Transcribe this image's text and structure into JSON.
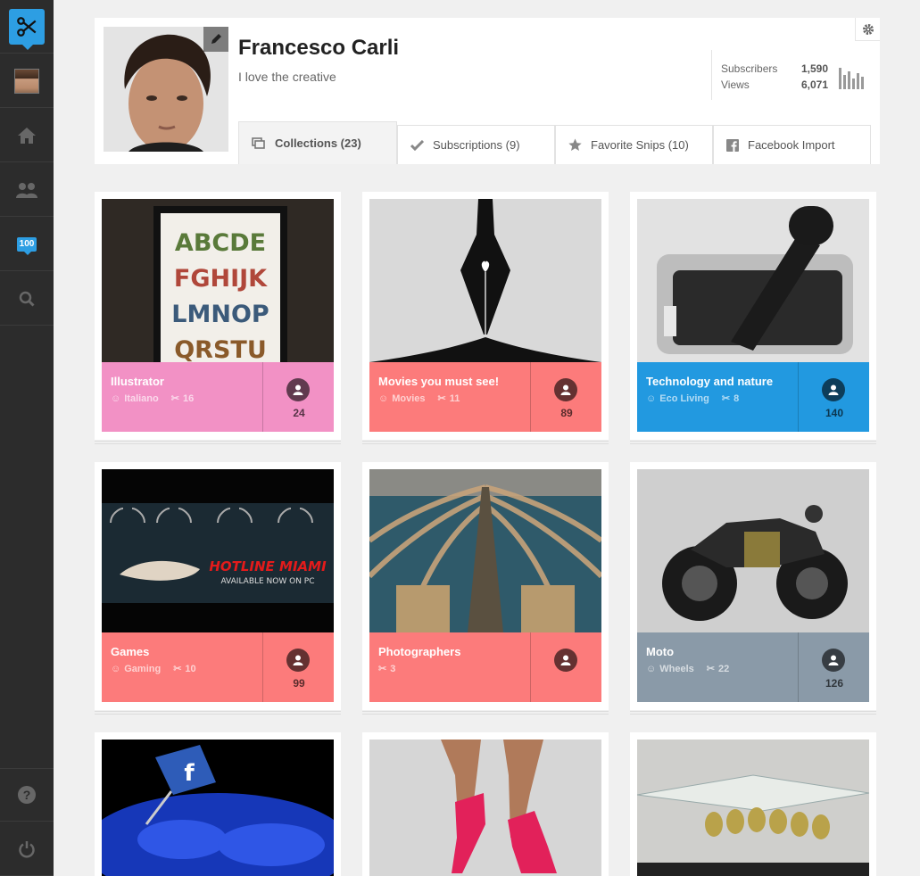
{
  "app": {
    "logo_icon": "scissors-icon",
    "accent": "#2d9ee3"
  },
  "sidebar": {
    "badge_count": "100",
    "items": [
      {
        "name": "home",
        "icon": "home-icon"
      },
      {
        "name": "people",
        "icon": "people-icon"
      },
      {
        "name": "notifications",
        "icon": "badge-icon"
      },
      {
        "name": "search",
        "icon": "search-icon"
      },
      {
        "name": "help",
        "icon": "help-icon"
      },
      {
        "name": "logout",
        "icon": "power-icon"
      }
    ]
  },
  "profile": {
    "name": "Francesco Carli",
    "bio": "I love the creative",
    "stats": [
      {
        "label": "Subscribers",
        "value": "1,590"
      },
      {
        "label": "Views",
        "value": "6,071"
      }
    ]
  },
  "tabs": [
    {
      "label": "Collections (23)",
      "icon": "collections-icon",
      "active": true
    },
    {
      "label": "Subscriptions (9)",
      "icon": "check-icon",
      "active": false
    },
    {
      "label": "Favorite Snips (10)",
      "icon": "star-icon",
      "active": false
    },
    {
      "label": "Facebook Import",
      "icon": "facebook-icon",
      "active": false
    }
  ],
  "collections": [
    {
      "title": "Illustrator",
      "category": "Italiano",
      "snips": "16",
      "subscribers": "24",
      "color": "#f291c5"
    },
    {
      "title": "Movies you must see!",
      "category": "Movies",
      "snips": "11",
      "subscribers": "89",
      "color": "#fc7b7b"
    },
    {
      "title": "Technology and nature",
      "category": "Eco Living",
      "snips": "8",
      "subscribers": "140",
      "color": "#2299e0"
    },
    {
      "title": "Games",
      "category": "Gaming",
      "snips": "10",
      "subscribers": "99",
      "color": "#fc7b7b"
    },
    {
      "title": "Photographers",
      "category": "",
      "snips": "3",
      "subscribers": "",
      "color": "#fc7b7b"
    },
    {
      "title": "Moto",
      "category": "Wheels",
      "snips": "22",
      "subscribers": "126",
      "color": "#8a9aa8"
    }
  ],
  "thumb_texts": {
    "alphabet_lines": [
      "ABCDE",
      "FGHIJK",
      "LMNOP",
      "QRSTU"
    ],
    "game_banner": "HOTLINE MIAMI",
    "game_sub": "AVAILABLE NOW ON PC",
    "fb_letter": "f"
  }
}
